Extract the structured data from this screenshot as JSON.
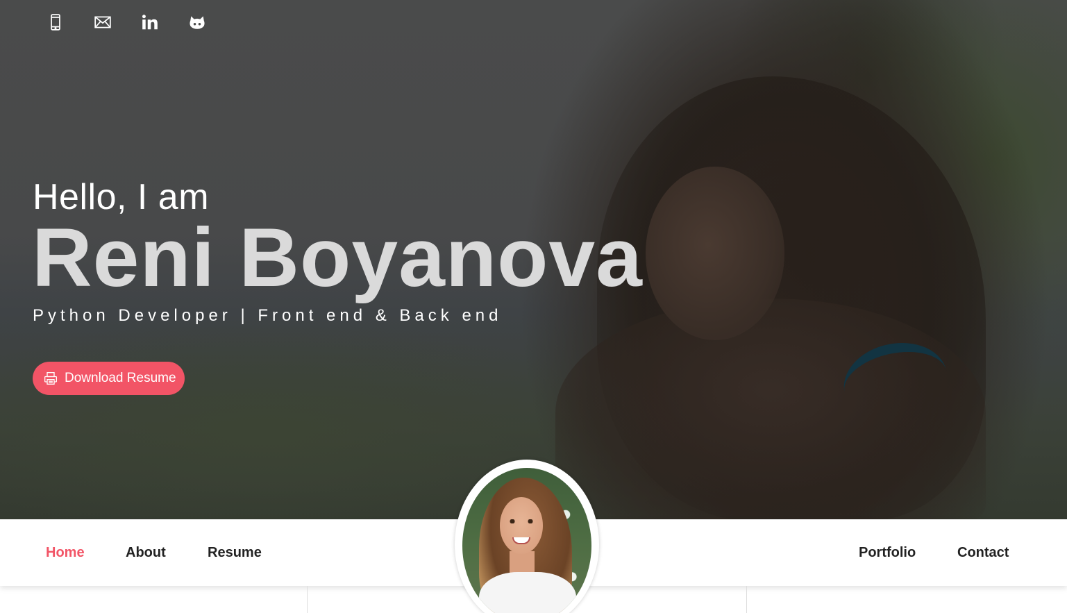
{
  "social": [
    {
      "name": "phone",
      "icon": "phone-icon"
    },
    {
      "name": "email",
      "icon": "mail-icon"
    },
    {
      "name": "linkedin",
      "icon": "linkedin-icon"
    },
    {
      "name": "github",
      "icon": "github-icon"
    }
  ],
  "hero": {
    "greeting": "Hello, I am",
    "name": "Reni Boyanova",
    "subtitle": "Python Developer | Front end & Back end",
    "download_label": "Download Resume"
  },
  "nav": {
    "home": "Home",
    "about": "About",
    "resume": "Resume",
    "portfolio": "Portfolio",
    "contact": "Contact"
  },
  "colors": {
    "accent": "#f25466",
    "nav_text": "#222222"
  }
}
